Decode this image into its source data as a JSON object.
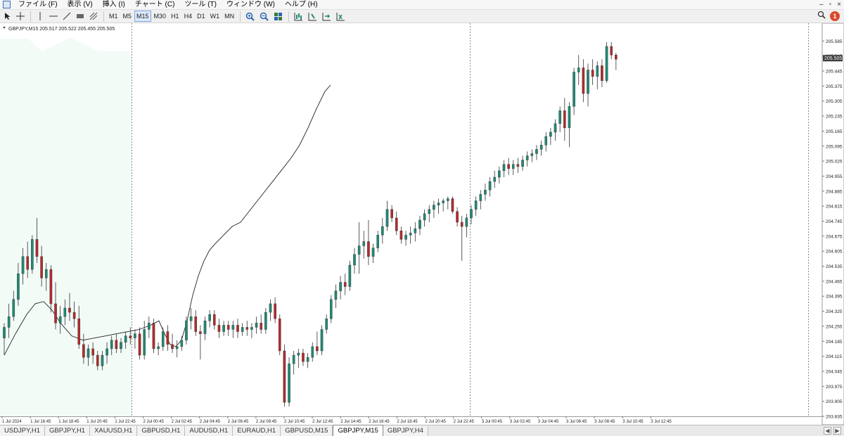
{
  "menu": {
    "items": [
      "ファイル (F)",
      "表示 (V)",
      "挿入 (I)",
      "チャート (C)",
      "ツール (T)",
      "ウィンドウ (W)",
      "ヘルプ (H)"
    ],
    "window_controls": [
      "–",
      "▫",
      "×"
    ]
  },
  "toolbar": {
    "timeframes": [
      "M1",
      "M5",
      "M15",
      "M30",
      "H1",
      "H4",
      "D1",
      "W1",
      "MN"
    ],
    "active_timeframe": "M15",
    "notification_count": "1"
  },
  "chart_header": "GBPJPY,M15  205.517 205.522 205.455 205.505",
  "chart_data": {
    "type": "candlestick",
    "symbol": "GBPJPY",
    "timeframe": "M15",
    "header_ohlc": {
      "open": 205.517,
      "high": 205.522,
      "low": 205.455,
      "close": 205.505
    },
    "current_price_label": "205.505",
    "ylim": [
      203.835,
      205.655
    ],
    "y_ticks": [
      "205.585",
      "205.515",
      "205.445",
      "205.375",
      "205.305",
      "205.235",
      "205.165",
      "205.095",
      "205.025",
      "204.955",
      "204.885",
      "204.815",
      "204.745",
      "204.675",
      "204.605",
      "204.535",
      "204.465",
      "204.395",
      "204.325",
      "204.255",
      "204.185",
      "204.115",
      "204.045",
      "203.975",
      "203.905",
      "203.835"
    ],
    "x_ticks": [
      "1 Jul 2024",
      "1 Jul 16:45",
      "1 Jul 18:45",
      "1 Jul 20:45",
      "1 Jul 22:45",
      "2 Jul 00:45",
      "2 Jul 02:45",
      "2 Jul 04:45",
      "2 Jul 06:45",
      "2 Jul 08:45",
      "2 Jul 10:45",
      "2 Jul 12:45",
      "2 Jul 14:45",
      "2 Jul 16:45",
      "2 Jul 18:45",
      "2 Jul 20:45",
      "2 Jul 22:45",
      "3 Jul 00:45",
      "3 Jul 02:45",
      "3 Jul 04:45",
      "3 Jul 06:45",
      "3 Jul 08:45",
      "3 Jul 10:45",
      "3 Jul 12:45"
    ],
    "up_color": "#1f8a74",
    "down_color": "#b52a2a",
    "ma_color": "#222222",
    "candles": [
      [
        204.2,
        204.27,
        204.12,
        204.25
      ],
      [
        204.25,
        204.36,
        204.2,
        204.3
      ],
      [
        204.3,
        204.42,
        204.28,
        204.38
      ],
      [
        204.38,
        204.55,
        204.35,
        204.5
      ],
      [
        204.5,
        204.62,
        204.45,
        204.58
      ],
      [
        204.58,
        204.65,
        204.48,
        204.52
      ],
      [
        204.52,
        204.68,
        204.5,
        204.66
      ],
      [
        204.66,
        204.76,
        204.55,
        204.58
      ],
      [
        204.58,
        204.63,
        204.44,
        204.48
      ],
      [
        204.48,
        204.55,
        204.42,
        204.52
      ],
      [
        204.52,
        204.54,
        204.32,
        204.36
      ],
      [
        204.36,
        204.46,
        204.24,
        204.27
      ],
      [
        204.27,
        204.35,
        204.22,
        204.3
      ],
      [
        204.3,
        204.38,
        204.26,
        204.34
      ],
      [
        204.34,
        204.41,
        204.28,
        204.32
      ],
      [
        204.32,
        204.37,
        204.25,
        204.29
      ],
      [
        204.29,
        204.35,
        204.15,
        204.17
      ],
      [
        204.17,
        204.22,
        204.08,
        204.11
      ],
      [
        204.11,
        204.17,
        204.07,
        204.15
      ],
      [
        204.15,
        204.18,
        204.08,
        204.12
      ],
      [
        204.12,
        204.14,
        204.05,
        204.07
      ],
      [
        204.07,
        204.14,
        204.05,
        204.12
      ],
      [
        204.12,
        204.18,
        204.08,
        204.15
      ],
      [
        204.15,
        204.21,
        204.12,
        204.19
      ],
      [
        204.19,
        204.22,
        204.13,
        204.15
      ],
      [
        204.15,
        204.2,
        204.13,
        204.18
      ],
      [
        204.18,
        204.23,
        204.15,
        204.21
      ],
      [
        204.21,
        204.25,
        204.17,
        204.2
      ],
      [
        204.2,
        204.24,
        204.15,
        204.22
      ],
      [
        204.22,
        204.25,
        204.1,
        204.12
      ],
      [
        204.12,
        204.28,
        204.1,
        204.24
      ],
      [
        204.24,
        204.3,
        204.2,
        204.27
      ],
      [
        204.27,
        204.29,
        204.13,
        204.15
      ],
      [
        204.15,
        204.18,
        204.12,
        204.16
      ],
      [
        204.16,
        204.25,
        204.14,
        204.23
      ],
      [
        204.23,
        204.26,
        204.14,
        204.17
      ],
      [
        204.17,
        204.22,
        204.13,
        204.15
      ],
      [
        204.15,
        204.19,
        204.11,
        204.16
      ],
      [
        204.16,
        204.21,
        204.14,
        204.19
      ],
      [
        204.19,
        204.3,
        204.17,
        204.28
      ],
      [
        204.28,
        204.34,
        204.24,
        204.3
      ],
      [
        204.3,
        204.33,
        204.21,
        204.23
      ],
      [
        204.23,
        204.26,
        204.1,
        204.22
      ],
      [
        204.22,
        204.3,
        204.19,
        204.28
      ],
      [
        204.28,
        204.33,
        204.25,
        204.31
      ],
      [
        204.31,
        204.33,
        204.24,
        204.26
      ],
      [
        204.26,
        204.29,
        204.2,
        204.23
      ],
      [
        204.23,
        204.28,
        204.21,
        204.26
      ],
      [
        204.26,
        204.28,
        204.21,
        204.24
      ],
      [
        204.24,
        204.28,
        204.2,
        204.26
      ],
      [
        204.26,
        204.29,
        204.2,
        204.23
      ],
      [
        204.23,
        204.27,
        204.21,
        204.25
      ],
      [
        204.25,
        204.28,
        204.21,
        204.24
      ],
      [
        204.24,
        204.27,
        204.2,
        204.25
      ],
      [
        204.25,
        204.3,
        204.22,
        204.27
      ],
      [
        204.27,
        204.31,
        204.22,
        204.24
      ],
      [
        204.24,
        204.34,
        204.22,
        204.32
      ],
      [
        204.32,
        204.38,
        204.28,
        204.36
      ],
      [
        204.36,
        204.39,
        204.27,
        204.29
      ],
      [
        204.29,
        204.31,
        204.12,
        204.14
      ],
      [
        204.14,
        204.17,
        203.88,
        203.9
      ],
      [
        203.9,
        204.11,
        203.88,
        204.08
      ],
      [
        204.08,
        204.14,
        204.03,
        204.12
      ],
      [
        204.12,
        204.15,
        204.06,
        204.13
      ],
      [
        204.13,
        204.15,
        204.07,
        204.09
      ],
      [
        204.09,
        204.13,
        204.06,
        204.11
      ],
      [
        204.11,
        204.18,
        204.09,
        204.16
      ],
      [
        204.16,
        204.23,
        204.12,
        204.14
      ],
      [
        204.14,
        204.26,
        204.12,
        204.24
      ],
      [
        204.24,
        204.31,
        204.22,
        204.29
      ],
      [
        204.29,
        204.4,
        204.27,
        204.38
      ],
      [
        204.38,
        204.45,
        204.34,
        204.42
      ],
      [
        204.42,
        204.49,
        204.38,
        204.46
      ],
      [
        204.46,
        204.5,
        204.4,
        204.44
      ],
      [
        204.44,
        204.56,
        204.42,
        204.54
      ],
      [
        204.54,
        204.62,
        204.5,
        204.59
      ],
      [
        204.59,
        204.74,
        204.5,
        204.63
      ],
      [
        204.63,
        204.7,
        204.57,
        204.65
      ],
      [
        204.65,
        204.75,
        204.54,
        204.58
      ],
      [
        204.58,
        204.64,
        204.55,
        204.62
      ],
      [
        204.62,
        204.7,
        204.6,
        204.68
      ],
      [
        204.68,
        204.76,
        204.64,
        204.72
      ],
      [
        204.72,
        204.84,
        204.7,
        204.8
      ],
      [
        204.8,
        204.82,
        204.74,
        204.76
      ],
      [
        204.76,
        204.79,
        204.68,
        204.7
      ],
      [
        204.7,
        204.72,
        204.64,
        204.66
      ],
      [
        204.66,
        204.7,
        204.63,
        204.68
      ],
      [
        204.68,
        204.72,
        204.64,
        204.69
      ],
      [
        204.69,
        204.74,
        204.65,
        204.71
      ],
      [
        204.71,
        204.77,
        204.68,
        204.75
      ],
      [
        204.75,
        204.8,
        204.72,
        204.78
      ],
      [
        204.78,
        204.82,
        204.74,
        204.8
      ],
      [
        204.8,
        204.84,
        204.76,
        204.82
      ],
      [
        204.82,
        204.85,
        204.78,
        204.83
      ],
      [
        204.83,
        204.85,
        204.79,
        204.84
      ],
      [
        204.84,
        204.86,
        204.8,
        204.85
      ],
      [
        204.85,
        204.86,
        204.78,
        204.79
      ],
      [
        204.79,
        204.81,
        204.72,
        204.74
      ],
      [
        204.74,
        204.77,
        204.56,
        204.72
      ],
      [
        204.72,
        204.78,
        204.67,
        204.76
      ],
      [
        204.76,
        204.82,
        204.73,
        204.8
      ],
      [
        204.8,
        204.86,
        204.77,
        204.84
      ],
      [
        204.84,
        204.89,
        204.8,
        204.87
      ],
      [
        204.87,
        204.92,
        204.84,
        204.89
      ],
      [
        204.89,
        204.95,
        204.86,
        204.93
      ],
      [
        204.93,
        204.98,
        204.9,
        204.95
      ],
      [
        204.95,
        205.0,
        204.92,
        204.98
      ],
      [
        204.98,
        205.03,
        204.95,
        205.01
      ],
      [
        205.01,
        205.04,
        204.96,
        204.99
      ],
      [
        204.99,
        205.03,
        204.96,
        205.01
      ],
      [
        205.01,
        205.04,
        204.97,
        205.0
      ],
      [
        205.0,
        205.05,
        204.98,
        205.03
      ],
      [
        205.03,
        205.07,
        205.0,
        205.05
      ],
      [
        205.05,
        205.08,
        205.02,
        205.06
      ],
      [
        205.06,
        205.1,
        205.03,
        205.08
      ],
      [
        205.08,
        205.12,
        205.05,
        205.1
      ],
      [
        205.1,
        205.16,
        205.07,
        205.14
      ],
      [
        205.14,
        205.18,
        205.1,
        205.16
      ],
      [
        205.16,
        205.22,
        205.12,
        205.2
      ],
      [
        205.2,
        205.28,
        205.16,
        205.26
      ],
      [
        205.26,
        205.32,
        205.12,
        205.18
      ],
      [
        205.18,
        205.3,
        205.09,
        205.28
      ],
      [
        205.28,
        205.46,
        205.24,
        205.44
      ],
      [
        205.44,
        205.52,
        205.38,
        205.46
      ],
      [
        205.46,
        205.5,
        205.3,
        205.34
      ],
      [
        205.34,
        205.48,
        205.28,
        205.45
      ],
      [
        205.45,
        205.5,
        205.38,
        205.42
      ],
      [
        205.42,
        205.49,
        205.36,
        205.47
      ],
      [
        205.47,
        205.5,
        205.37,
        205.4
      ],
      [
        205.4,
        205.58,
        205.39,
        205.56
      ],
      [
        205.56,
        205.58,
        205.5,
        205.52
      ],
      [
        205.52,
        205.53,
        205.45,
        205.5
      ]
    ],
    "ma_period_values": [
      [
        0,
        204.12
      ],
      [
        8,
        204.22
      ],
      [
        16,
        204.31
      ],
      [
        22,
        204.36
      ],
      [
        28,
        204.37
      ],
      [
        34,
        204.33
      ],
      [
        40,
        204.27
      ],
      [
        48,
        204.21
      ],
      [
        56,
        204.19
      ],
      [
        64,
        204.2
      ],
      [
        72,
        204.21
      ],
      [
        80,
        204.22
      ],
      [
        88,
        204.23
      ],
      [
        96,
        204.24
      ],
      [
        104,
        204.26
      ],
      [
        110,
        204.28
      ],
      [
        114,
        204.22
      ],
      [
        118,
        204.17
      ],
      [
        122,
        204.16
      ],
      [
        126,
        204.19
      ],
      [
        130,
        204.28
      ],
      [
        134,
        204.4
      ],
      [
        138,
        204.49
      ],
      [
        142,
        204.56
      ],
      [
        146,
        204.61
      ],
      [
        150,
        204.64
      ],
      [
        156,
        204.68
      ],
      [
        162,
        204.72
      ],
      [
        168,
        204.74
      ],
      [
        174,
        204.79
      ],
      [
        180,
        204.84
      ],
      [
        186,
        204.89
      ],
      [
        192,
        204.94
      ],
      [
        198,
        204.99
      ],
      [
        204,
        205.04
      ],
      [
        210,
        205.1
      ],
      [
        216,
        205.18
      ],
      [
        222,
        205.27
      ],
      [
        228,
        205.35
      ],
      [
        232,
        205.38
      ]
    ]
  },
  "tabs": [
    "USDJPY,H1",
    "GBPJPY,H1",
    "XAUUSD,H1",
    "GBPUSD,H1",
    "AUDUSD,H1",
    "EURAUD,H1",
    "GBPUSD,M15",
    "GBPJPY,M15",
    "GBPJPY,H4"
  ],
  "active_tab": "GBPJPY,M15"
}
